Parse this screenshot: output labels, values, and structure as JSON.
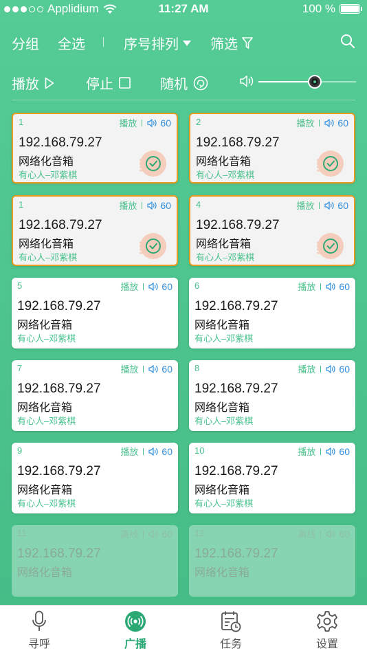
{
  "status": {
    "carrier": "Applidium",
    "time": "11:27 AM",
    "battery": "100 %"
  },
  "toolbar": {
    "group": "分组",
    "select_all": "全选",
    "sort": "序号排列",
    "filter": "筛选"
  },
  "controls": {
    "play": "播放",
    "stop": "停止",
    "random": "随机",
    "volume_level": 0.58
  },
  "colors": {
    "accent": "#49c18c",
    "selected_border": "#e69b20",
    "volume_blue": "#2f8fdd"
  },
  "devices": [
    {
      "num": "1",
      "state": "播放",
      "volume": "60",
      "ip": "192.168.79.27",
      "name": "网络化音箱",
      "owner": "有心人–邓紫棋"
    },
    {
      "num": "2",
      "state": "播放",
      "volume": "60",
      "ip": "192.168.79.27",
      "name": "网络化音箱",
      "owner": "有心人–邓紫棋"
    },
    {
      "num": "1",
      "state": "播放",
      "volume": "60",
      "ip": "192.168.79.27",
      "name": "网络化音箱",
      "owner": "有心人–邓紫棋"
    },
    {
      "num": "4",
      "state": "播放",
      "volume": "60",
      "ip": "192.168.79.27",
      "name": "网络化音箱",
      "owner": "有心人–邓紫棋"
    },
    {
      "num": "5",
      "state": "播放",
      "volume": "60",
      "ip": "192.168.79.27",
      "name": "网络化音箱",
      "owner": "有心人–邓紫棋"
    },
    {
      "num": "6",
      "state": "播放",
      "volume": "60",
      "ip": "192.168.79.27",
      "name": "网络化音箱",
      "owner": "有心人–邓紫棋"
    },
    {
      "num": "7",
      "state": "播放",
      "volume": "60",
      "ip": "192.168.79.27",
      "name": "网络化音箱",
      "owner": "有心人–邓紫棋"
    },
    {
      "num": "8",
      "state": "播放",
      "volume": "60",
      "ip": "192.168.79.27",
      "name": "网络化音箱",
      "owner": "有心人–邓紫棋"
    },
    {
      "num": "9",
      "state": "播放",
      "volume": "60",
      "ip": "192.168.79.27",
      "name": "网络化音箱",
      "owner": "有心人–邓紫棋"
    },
    {
      "num": "10",
      "state": "播放",
      "volume": "60",
      "ip": "192.168.79.27",
      "name": "网络化音箱",
      "owner": "有心人–邓紫棋"
    },
    {
      "num": "11",
      "state": "离线",
      "volume": "60",
      "ip": "192.168.79.27",
      "name": "网络化音箱",
      "owner": ""
    },
    {
      "num": "12",
      "state": "离线",
      "volume": "60",
      "ip": "192.168.79.27",
      "name": "网络化音箱",
      "owner": ""
    }
  ],
  "tabs": [
    {
      "label": "寻呼",
      "icon": "microphone-icon"
    },
    {
      "label": "广播",
      "icon": "broadcast-icon"
    },
    {
      "label": "任务",
      "icon": "calendar-icon"
    },
    {
      "label": "设置",
      "icon": "gear-icon"
    }
  ]
}
